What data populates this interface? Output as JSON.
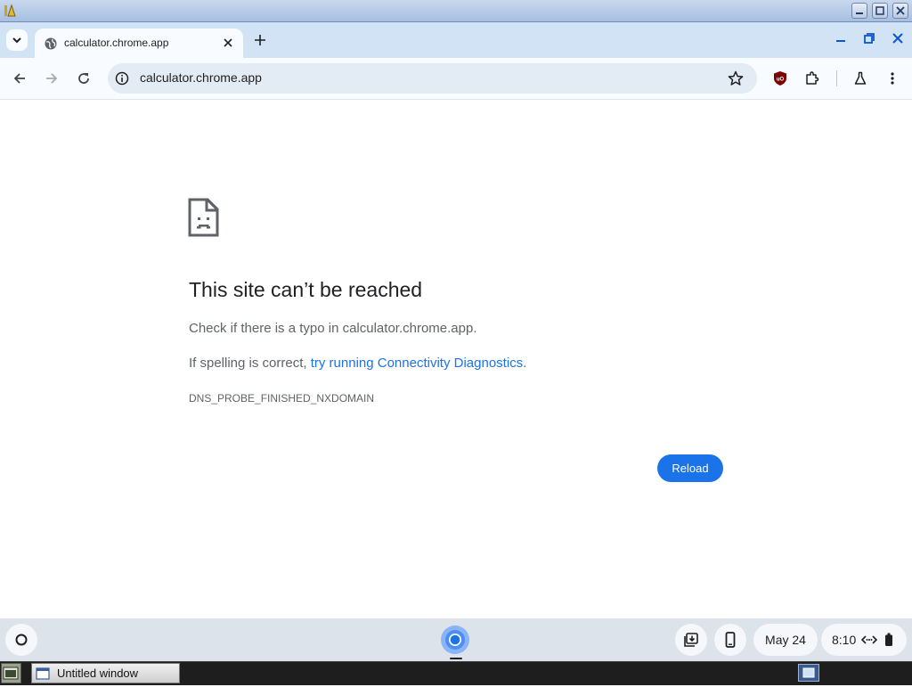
{
  "x_window": {
    "title": ""
  },
  "tab": {
    "title": "calculator.chrome.app"
  },
  "omnibox": {
    "url": "calculator.chrome.app"
  },
  "error": {
    "title": "This site can’t be reached",
    "line1": "Check if there is a typo in calculator.chrome.app.",
    "line2_prefix": "If spelling is correct, ",
    "line2_link": "try running Connectivity Diagnostics",
    "line2_suffix": ".",
    "code": "DNS_PROBE_FINISHED_NXDOMAIN",
    "reload_label": "Reload"
  },
  "shelf": {
    "date": "May 24",
    "time": "8:10"
  },
  "taskbar": {
    "window_label": "Untitled window"
  },
  "colors": {
    "accent": "#1a73e8",
    "tabstrip": "#d3e3f6",
    "shelf": "#dde3ea"
  }
}
